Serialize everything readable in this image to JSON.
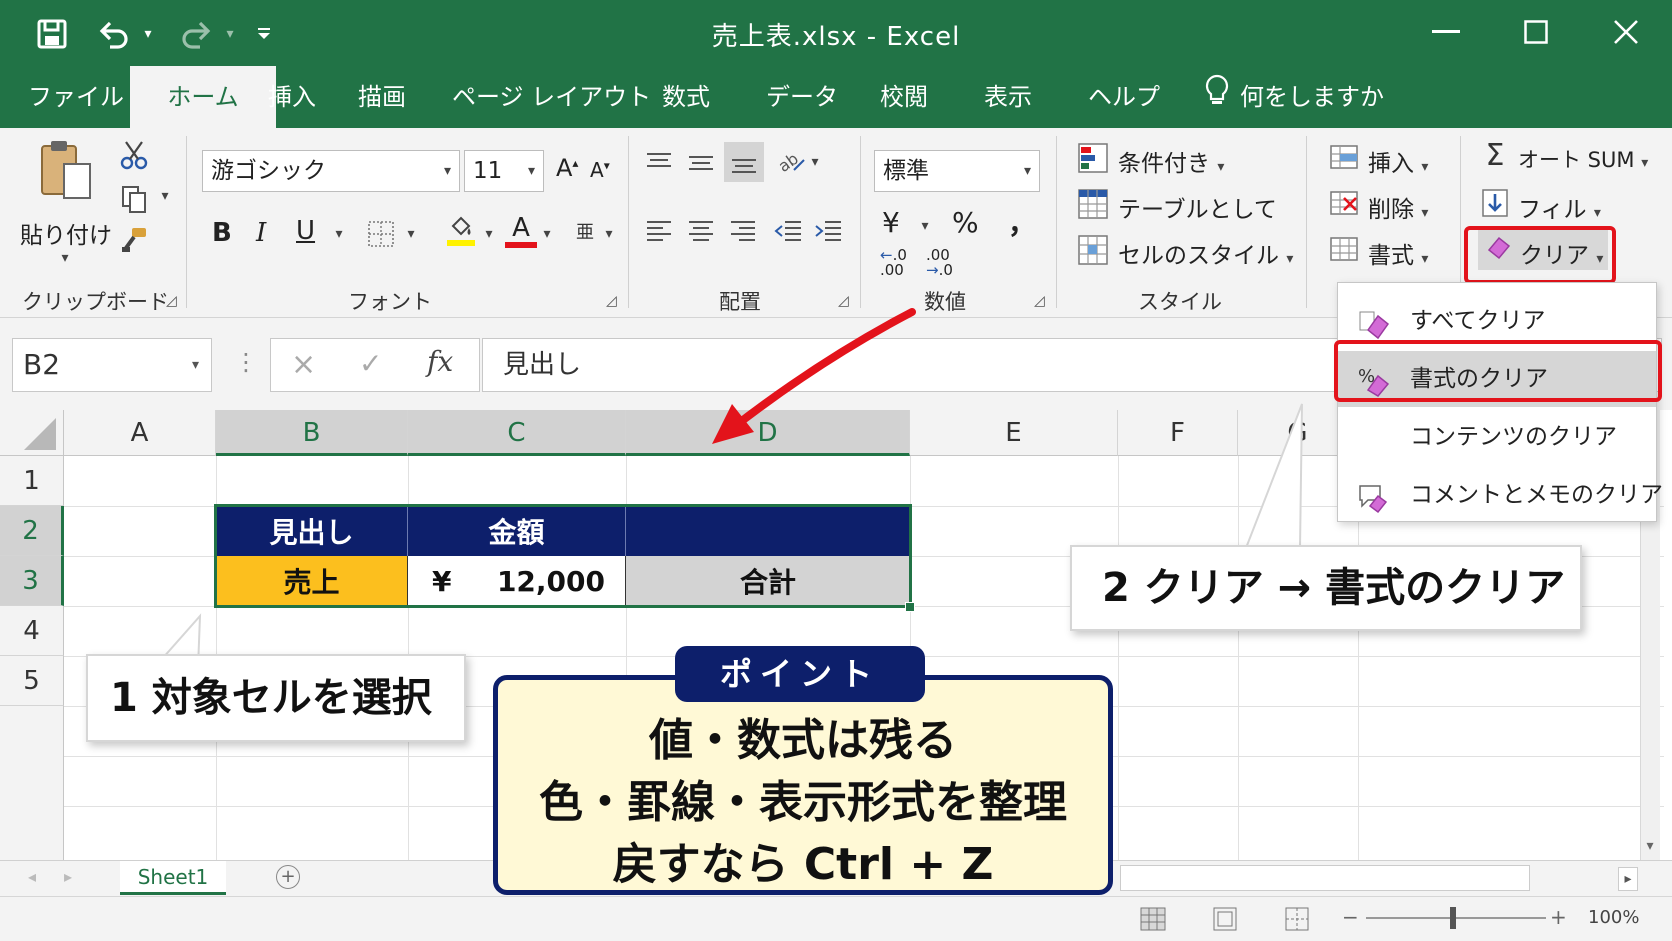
{
  "window": {
    "title": "売上表.xlsx  -  Excel",
    "quick_access_icons": [
      "save-icon",
      "undo-icon",
      "redo-icon",
      "customize-icon"
    ],
    "controls": [
      "minimize-icon",
      "maximize-icon",
      "close-icon"
    ]
  },
  "tabs": [
    "ファイル",
    "ホーム",
    "挿入",
    "描画",
    "ページ レイアウト",
    "数式",
    "データ",
    "校閲",
    "表示",
    "ヘルプ"
  ],
  "active_tab": "ホーム",
  "tell_me": "何をしますか",
  "ribbon": {
    "clipboard": {
      "paste": "貼り付け",
      "label": "クリップボード"
    },
    "font": {
      "name": "游ゴシック",
      "size": "11",
      "bold": "B",
      "italic": "I",
      "underline": "U",
      "grow": "A",
      "shrink": "A",
      "font_color": "A",
      "phonetic": "亜",
      "label": "フォント"
    },
    "alignment": {
      "label": "配置"
    },
    "number": {
      "format": "標準",
      "currency": "¥",
      "percent": "%",
      "comma": "，",
      "inc": ".00",
      "dec": ".00",
      "label": "数値"
    },
    "styles": {
      "conditional": "条件付き",
      "table": "テーブルとして",
      "cell_styles": "セルのスタイル",
      "label": "スタイル"
    },
    "cells": {
      "insert": "挿入",
      "delete": "削除",
      "format": "書式"
    },
    "editing": {
      "autosum": "オート SUM",
      "fill": "フィル",
      "clear": "クリア"
    }
  },
  "clear_menu": [
    "すべてクリア",
    "書式のクリア",
    "コンテンツのクリア",
    "コメントとメモのクリア"
  ],
  "formula_bar": {
    "name_box": "B2",
    "fx": "fx",
    "value": "見出し",
    "cancel": "×",
    "enter": "✓",
    "dots": "⋮"
  },
  "columns": [
    "A",
    "B",
    "C",
    "D",
    "E",
    "F",
    "G"
  ],
  "rows": [
    "1",
    "2",
    "3",
    "4",
    "5"
  ],
  "cells": {
    "b2": "見出し",
    "c2": "金額",
    "b3": "売上",
    "c3_currency": "¥",
    "c3": "12,000",
    "d3": "合計"
  },
  "sheet_tab": "Sheet1",
  "zoom": "100%",
  "annotations": {
    "step1": "1 対象セルを選択",
    "step2": "2 クリア → 書式のクリア",
    "point_tag": "ポイント",
    "point_lines": [
      "値・数式は残る",
      "色・罫線・表示形式を整理",
      "戻すなら Ctrl + Z"
    ]
  },
  "colors": {
    "excel_green": "#217346",
    "header_navy": "#0d1f6b",
    "sales_yellow": "#fcbf1e",
    "total_gray": "#d3d3d3",
    "highlight_red": "#e3131b"
  }
}
